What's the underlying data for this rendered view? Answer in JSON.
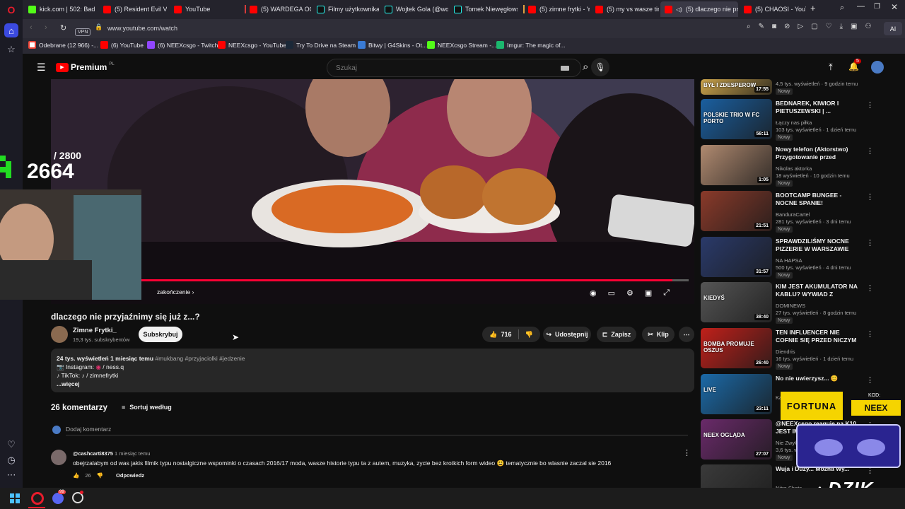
{
  "browser": {
    "tabs": [
      {
        "label": "kick.com | 502: Bad g",
        "icon": "kick-icon"
      },
      {
        "label": "(5) Resident Evil Villa",
        "icon": "youtube-icon"
      },
      {
        "label": "YouTube",
        "icon": "youtube-icon"
      },
      {
        "label": "(5) WARDEGA OGLĄ",
        "icon": "youtube-icon"
      },
      {
        "label": "Filmy użytkownika sc",
        "icon": "tiktok-icon"
      },
      {
        "label": "Wojtek Gola (@wojte",
        "icon": "tiktok-icon"
      },
      {
        "label": "Tomek Niewęgłowsk",
        "icon": "tiktok-icon"
      },
      {
        "label": "(5) zimne frytki - You",
        "icon": "youtube-icon"
      },
      {
        "label": "(5) my vs wasze tinde",
        "icon": "youtube-icon"
      },
      {
        "label": "(5) dlaczego nie przyja",
        "icon": "youtube-icon"
      },
      {
        "label": "(5) CHAOSI - YouTub",
        "icon": "youtube-icon"
      }
    ],
    "url": "www.youtube.com/watch",
    "vpn_label": "VPN",
    "ai_label": "AI",
    "bookmarks": [
      {
        "label": "Odebrane (12 966) -...",
        "icon": "gmail-icon"
      },
      {
        "label": "(6) YouTube",
        "icon": "youtube-icon"
      },
      {
        "label": "(6) NEEXcsgo - Twitch",
        "icon": "twitch-icon"
      },
      {
        "label": "NEEXcsgo - YouTube",
        "icon": "youtube-icon"
      },
      {
        "label": "Try To Drive na Steam",
        "icon": "steam-icon"
      },
      {
        "label": "Bitwy | G4Skins - Ot...",
        "icon": "g4skins-icon"
      },
      {
        "label": "NEEXcsgo Stream -...",
        "icon": "kick-icon"
      },
      {
        "label": "Imgur: The magic of...",
        "icon": "imgur-icon"
      }
    ]
  },
  "youtube": {
    "logo_text": "Premium",
    "logo_region": "PL",
    "search_placeholder": "Szukaj",
    "notification_count": "5",
    "video": {
      "chapter_label": "zakończenie",
      "progress_fraction": 0.97,
      "title": "dlaczego nie przyjaźnimy się już z...?",
      "channel": "Zimne Frytki_",
      "subscribers": "19,3 tys. subskrybentów",
      "subscribe_label": "Subskrybuj",
      "likes": "716",
      "share_label": "Udostępnij",
      "save_label": "Zapisz",
      "clip_label": "Klip"
    },
    "description": {
      "views": "24 tys. wyświetleń",
      "date": "1 miesiąc temu",
      "hashtags": "#mukbang #przyjaciolki #jedzenie",
      "line2_label": "📷 Instagram:",
      "line2_value": "/ ness.q",
      "line3_label": "♪ TikTok:",
      "line3_value": "/ zimnefrytki",
      "more": "...więcej"
    },
    "comments": {
      "count_label": "26 komentarzy",
      "sort_label": "Sortuj według",
      "add_placeholder": "Dodaj komentarz",
      "items": [
        {
          "author": "@cashcarti8375",
          "time": "1 miesiąc temu",
          "text": "obejrzalabym od was jakis filmik typu nostalgiczne wspominki o czasach 2016/17 moda, wasze historie typu ta z autem, muzyka, zycie bez krotkich form wideo 😩 tematycznie bo wlasnie zaczal sie 2016",
          "likes": "26",
          "reply_label": "Odpowiedz"
        }
      ]
    },
    "sidebar": [
      {
        "title": "",
        "channel": "",
        "meta": "4,5 tys. wyświetleń · 9 godzin temu",
        "badge": "Nowy",
        "duration": "17:55",
        "thumb_text": "BYŁ I ZDESPEROW",
        "thumb_color": "#c9a24a"
      },
      {
        "title": "BEDNAREK, KIWIOR I PIETUSZEWSKI | ...",
        "channel": "Łączy nas piłka",
        "meta": "103 tys. wyświetleń · 1 dzień temu",
        "badge": "Nowy",
        "duration": "58:11",
        "thumb_text": "POLSKIE TRIO W FC PORTO",
        "thumb_color": "#1a5fa0"
      },
      {
        "title": "Nowy telefon (Aktorstwo) Przygotowanie przed reklamą",
        "channel": "Nikolas aktorka",
        "meta": "18 wyświetleń · 10 godzin temu",
        "badge": "Nowy",
        "duration": "1:05",
        "thumb_text": "",
        "thumb_color": "#b08a70"
      },
      {
        "title": "BOOTCAMP BUNGEE - NOCNE SPANIE!",
        "channel": "BanduraCartel",
        "meta": "281 tys. wyświetleń · 3 dni temu",
        "badge": "Nowy",
        "duration": "21:51",
        "thumb_text": "",
        "thumb_color": "#8a3a2a"
      },
      {
        "title": "SPRAWDZILIŚMY NOCNE PIZZERIE W WARSZAWIE",
        "channel": "NA HAPSA",
        "meta": "500 tys. wyświetleń · 4 dni temu",
        "badge": "Nowy",
        "duration": "31:57",
        "thumb_text": "",
        "thumb_color": "#2a3a6a"
      },
      {
        "title": "KIM JEST AKUMULATOR NA KABLU? WYWIAD Z LEGENDĄ ...",
        "channel": "DOMINEWS",
        "meta": "27 tys. wyświetleń · 8 godzin temu",
        "badge": "Nowy",
        "duration": "38:40",
        "thumb_text": "KIEDYŚ",
        "thumb_color": "#555555"
      },
      {
        "title": "TEN INFLUENCER NIE COFNIE SIĘ PRZED NICZYM",
        "channel": "Diendris",
        "meta": "16 tys. wyświetleń · 1 dzień temu",
        "badge": "Nowy",
        "duration": "26:40",
        "thumb_text": "BOMBA PROMUJE OSZUS",
        "thumb_color": "#c0201a"
      },
      {
        "title": "No nie uwierzysz... 😊",
        "channel": "Kapulent",
        "meta": "",
        "badge": "",
        "duration": "23:11",
        "thumb_text": "LIVE",
        "thumb_color": "#1b6aa8"
      },
      {
        "title": "@NEEXcsgo reaguje na K10 JEST IM...",
        "channel": "Nie Zwyk...",
        "meta": "3,6 tys. wyś...",
        "badge": "Nowy",
        "duration": "27:07",
        "thumb_text": "NEEX OGLĄDA",
        "thumb_color": "#6a2a6a"
      },
      {
        "title": "Wuja i Duży... Można Wy...",
        "channel": "Nitro Shots",
        "meta": "",
        "badge": "",
        "duration": "",
        "thumb_text": "",
        "thumb_color": "#3a3a3a"
      }
    ]
  },
  "stream_overlay": {
    "score_max": "/ 2800",
    "score_current": "2664",
    "sponsor_code_label": "KOD:",
    "sponsor_name": "FORTUNA",
    "sponsor_code": "NEEX",
    "brand_logo": "DZIK"
  },
  "taskbar": {
    "discord_badge": "99"
  },
  "colors": {
    "yt_red": "#ff0000",
    "accent_red": "#ff0033",
    "fortuna_yellow": "#f5d400"
  }
}
